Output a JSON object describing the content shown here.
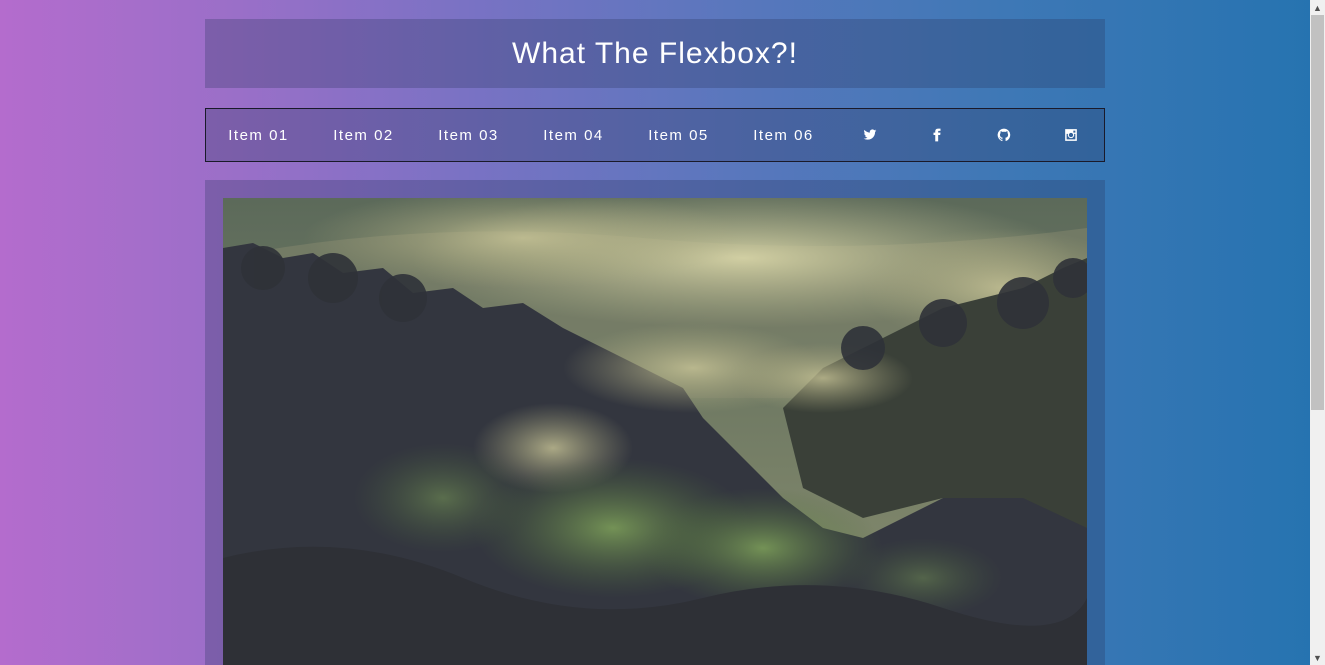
{
  "header": {
    "title": "What The Flexbox?!"
  },
  "nav": {
    "items": [
      {
        "label": "Item 01"
      },
      {
        "label": "Item 02"
      },
      {
        "label": "Item 03"
      },
      {
        "label": "Item 04"
      },
      {
        "label": "Item 05"
      },
      {
        "label": "Item 06"
      }
    ],
    "icons": [
      "twitter-icon",
      "facebook-icon",
      "github-icon",
      "instagram-icon"
    ]
  },
  "content": {
    "image": "misty-forest-photo"
  },
  "colors": {
    "gradient_start": "#b46ccd",
    "gradient_end": "#2573b0",
    "text": "#ffffff"
  },
  "scrollbar": {
    "up_arrow": "▲",
    "down_arrow": "▼"
  }
}
